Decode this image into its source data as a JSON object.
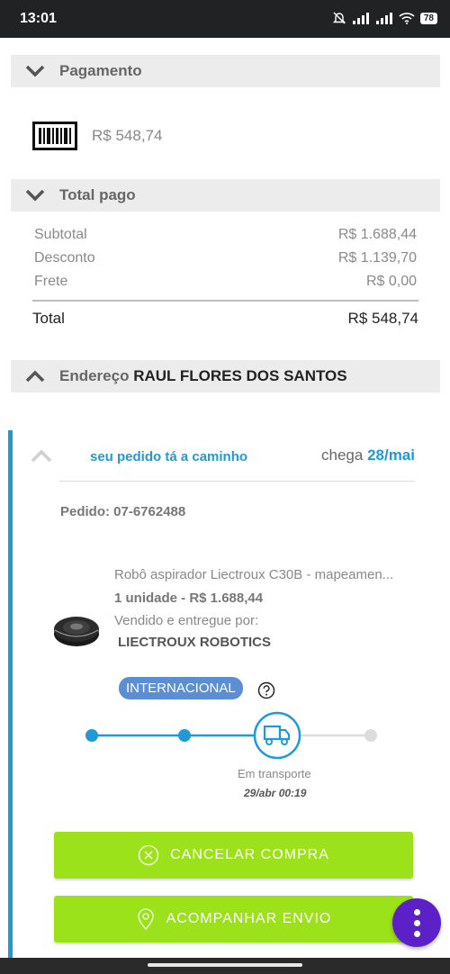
{
  "status_bar": {
    "time": "13:01",
    "battery": "78"
  },
  "payment": {
    "title": "Pagamento",
    "amount": "R$ 548,74"
  },
  "total_paid": {
    "title": "Total pago",
    "rows": [
      {
        "label": "Subtotal",
        "value": "R$ 1.688,44"
      },
      {
        "label": "Desconto",
        "value": "R$ 1.139,70"
      },
      {
        "label": "Frete",
        "value": "R$ 0,00"
      }
    ],
    "total_label": "Total",
    "total_value": "R$ 548,74"
  },
  "address": {
    "prefix": "Endereço",
    "name": "RAUL FLORES DOS SANTOS"
  },
  "order": {
    "status": "seu pedido tá a caminho",
    "eta_prefix": "chega",
    "eta_date": "28/mai",
    "order_number": "Pedido: 07-6762488",
    "product_name": "Robô aspirador Liectroux C30B - mapeamen...",
    "quantity": "1 unidade - R$ 1.688,44",
    "seller_label": "Vendido e entregue por:",
    "seller_name": "LIECTROUX ROBOTICS",
    "badge": "INTERNACIONAL",
    "tracking_label": "Em transporte",
    "tracking_time": "29/abr 00:19",
    "cancel_button": "CANCELAR COMPRA",
    "track_button": "ACOMPANHAR ENVIO"
  },
  "colors": {
    "accent_blue": "#1e9bd7",
    "button_green": "#9be21b",
    "fab_purple": "#5b20c7",
    "badge_blue": "#5b8ed3"
  }
}
